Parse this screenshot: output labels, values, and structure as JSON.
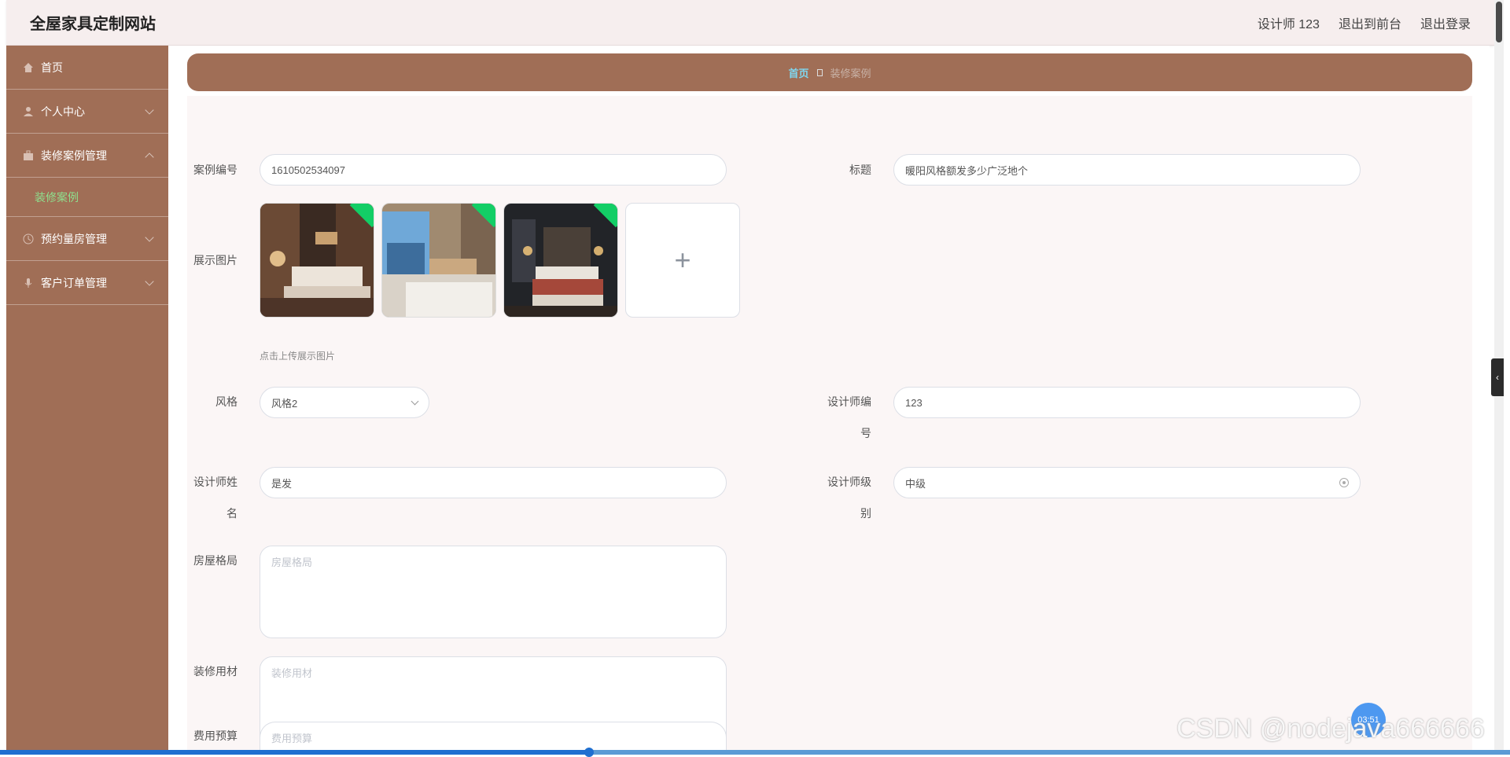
{
  "header": {
    "site_title": "全屋家具定制网站",
    "user_label": "设计师 123",
    "back_to_front": "退出到前台",
    "logout": "退出登录"
  },
  "sidebar": {
    "items": [
      {
        "label": "首页",
        "icon": "home-icon"
      },
      {
        "label": "个人中心",
        "icon": "user-icon"
      },
      {
        "label": "装修案例管理",
        "icon": "briefcase-icon"
      },
      {
        "label": "装修案例",
        "icon": ""
      },
      {
        "label": "预约量房管理",
        "icon": "clock-icon"
      },
      {
        "label": "客户订单管理",
        "icon": "mic-icon"
      }
    ]
  },
  "breadcrumb": {
    "home": "首页",
    "current": "装修案例"
  },
  "form": {
    "case_no_label": "案例编号",
    "case_no_value": "1610502534097",
    "title_label": "标题",
    "title_value": "暖阳风格额发多少广泛地个",
    "images_label": "展示图片",
    "upload_hint": "点击上传展示图片",
    "upload_plus": "+",
    "style_label": "风格",
    "style_value": "风格2",
    "designer_no_label_1": "设计师编",
    "designer_no_label_2": "号",
    "designer_no_value": "123",
    "designer_name_label_1": "设计师姓",
    "designer_name_label_2": "名",
    "designer_name_value": "是发",
    "designer_level_label_1": "设计师级",
    "designer_level_label_2": "别",
    "designer_level_value": "中级",
    "layout_label": "房屋格局",
    "layout_placeholder": "房屋格局",
    "material_label": "装修用材",
    "material_placeholder": "装修用材",
    "budget_label": "费用预算",
    "budget_placeholder": "费用预算"
  },
  "overlay": {
    "timer": "03:51",
    "watermark": "CSDN @nodejava666666",
    "video_progress": 0.39
  },
  "colors": {
    "sidebar_bg": "#a06e56",
    "active_sub": "#8ee08e",
    "breadcrumb_home": "#7fd7f0",
    "upload_success": "#13ce66"
  }
}
